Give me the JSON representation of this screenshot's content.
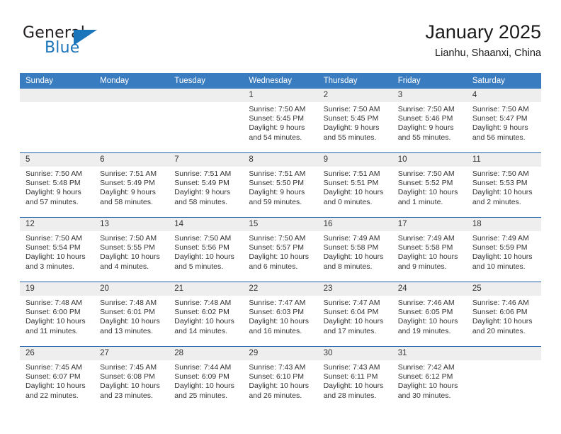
{
  "brand": {
    "name_part1": "General",
    "name_part2": "Blue",
    "logo_icon": "triangle-logo-icon",
    "accent_color": "#1b75bb"
  },
  "header": {
    "month_title": "January 2025",
    "location": "Lianhu, Shaanxi, China"
  },
  "calendar": {
    "header_bg": "#3a7cc0",
    "date_band_bg": "#eeeeee",
    "row_divider_color": "#1e5fa8",
    "weekday_headers": [
      "Sunday",
      "Monday",
      "Tuesday",
      "Wednesday",
      "Thursday",
      "Friday",
      "Saturday"
    ],
    "weeks": [
      [
        {
          "day": "",
          "empty": true,
          "sunrise": "",
          "sunset": "",
          "daylight_line1": "",
          "daylight_line2": ""
        },
        {
          "day": "",
          "empty": true,
          "sunrise": "",
          "sunset": "",
          "daylight_line1": "",
          "daylight_line2": ""
        },
        {
          "day": "",
          "empty": true,
          "sunrise": "",
          "sunset": "",
          "daylight_line1": "",
          "daylight_line2": ""
        },
        {
          "day": "1",
          "sunrise": "Sunrise: 7:50 AM",
          "sunset": "Sunset: 5:45 PM",
          "daylight_line1": "Daylight: 9 hours",
          "daylight_line2": "and 54 minutes."
        },
        {
          "day": "2",
          "sunrise": "Sunrise: 7:50 AM",
          "sunset": "Sunset: 5:45 PM",
          "daylight_line1": "Daylight: 9 hours",
          "daylight_line2": "and 55 minutes."
        },
        {
          "day": "3",
          "sunrise": "Sunrise: 7:50 AM",
          "sunset": "Sunset: 5:46 PM",
          "daylight_line1": "Daylight: 9 hours",
          "daylight_line2": "and 55 minutes."
        },
        {
          "day": "4",
          "sunrise": "Sunrise: 7:50 AM",
          "sunset": "Sunset: 5:47 PM",
          "daylight_line1": "Daylight: 9 hours",
          "daylight_line2": "and 56 minutes."
        }
      ],
      [
        {
          "day": "5",
          "sunrise": "Sunrise: 7:50 AM",
          "sunset": "Sunset: 5:48 PM",
          "daylight_line1": "Daylight: 9 hours",
          "daylight_line2": "and 57 minutes."
        },
        {
          "day": "6",
          "sunrise": "Sunrise: 7:51 AM",
          "sunset": "Sunset: 5:49 PM",
          "daylight_line1": "Daylight: 9 hours",
          "daylight_line2": "and 58 minutes."
        },
        {
          "day": "7",
          "sunrise": "Sunrise: 7:51 AM",
          "sunset": "Sunset: 5:49 PM",
          "daylight_line1": "Daylight: 9 hours",
          "daylight_line2": "and 58 minutes."
        },
        {
          "day": "8",
          "sunrise": "Sunrise: 7:51 AM",
          "sunset": "Sunset: 5:50 PM",
          "daylight_line1": "Daylight: 9 hours",
          "daylight_line2": "and 59 minutes."
        },
        {
          "day": "9",
          "sunrise": "Sunrise: 7:51 AM",
          "sunset": "Sunset: 5:51 PM",
          "daylight_line1": "Daylight: 10 hours",
          "daylight_line2": "and 0 minutes."
        },
        {
          "day": "10",
          "sunrise": "Sunrise: 7:50 AM",
          "sunset": "Sunset: 5:52 PM",
          "daylight_line1": "Daylight: 10 hours",
          "daylight_line2": "and 1 minute."
        },
        {
          "day": "11",
          "sunrise": "Sunrise: 7:50 AM",
          "sunset": "Sunset: 5:53 PM",
          "daylight_line1": "Daylight: 10 hours",
          "daylight_line2": "and 2 minutes."
        }
      ],
      [
        {
          "day": "12",
          "sunrise": "Sunrise: 7:50 AM",
          "sunset": "Sunset: 5:54 PM",
          "daylight_line1": "Daylight: 10 hours",
          "daylight_line2": "and 3 minutes."
        },
        {
          "day": "13",
          "sunrise": "Sunrise: 7:50 AM",
          "sunset": "Sunset: 5:55 PM",
          "daylight_line1": "Daylight: 10 hours",
          "daylight_line2": "and 4 minutes."
        },
        {
          "day": "14",
          "sunrise": "Sunrise: 7:50 AM",
          "sunset": "Sunset: 5:56 PM",
          "daylight_line1": "Daylight: 10 hours",
          "daylight_line2": "and 5 minutes."
        },
        {
          "day": "15",
          "sunrise": "Sunrise: 7:50 AM",
          "sunset": "Sunset: 5:57 PM",
          "daylight_line1": "Daylight: 10 hours",
          "daylight_line2": "and 6 minutes."
        },
        {
          "day": "16",
          "sunrise": "Sunrise: 7:49 AM",
          "sunset": "Sunset: 5:58 PM",
          "daylight_line1": "Daylight: 10 hours",
          "daylight_line2": "and 8 minutes."
        },
        {
          "day": "17",
          "sunrise": "Sunrise: 7:49 AM",
          "sunset": "Sunset: 5:58 PM",
          "daylight_line1": "Daylight: 10 hours",
          "daylight_line2": "and 9 minutes."
        },
        {
          "day": "18",
          "sunrise": "Sunrise: 7:49 AM",
          "sunset": "Sunset: 5:59 PM",
          "daylight_line1": "Daylight: 10 hours",
          "daylight_line2": "and 10 minutes."
        }
      ],
      [
        {
          "day": "19",
          "sunrise": "Sunrise: 7:48 AM",
          "sunset": "Sunset: 6:00 PM",
          "daylight_line1": "Daylight: 10 hours",
          "daylight_line2": "and 11 minutes."
        },
        {
          "day": "20",
          "sunrise": "Sunrise: 7:48 AM",
          "sunset": "Sunset: 6:01 PM",
          "daylight_line1": "Daylight: 10 hours",
          "daylight_line2": "and 13 minutes."
        },
        {
          "day": "21",
          "sunrise": "Sunrise: 7:48 AM",
          "sunset": "Sunset: 6:02 PM",
          "daylight_line1": "Daylight: 10 hours",
          "daylight_line2": "and 14 minutes."
        },
        {
          "day": "22",
          "sunrise": "Sunrise: 7:47 AM",
          "sunset": "Sunset: 6:03 PM",
          "daylight_line1": "Daylight: 10 hours",
          "daylight_line2": "and 16 minutes."
        },
        {
          "day": "23",
          "sunrise": "Sunrise: 7:47 AM",
          "sunset": "Sunset: 6:04 PM",
          "daylight_line1": "Daylight: 10 hours",
          "daylight_line2": "and 17 minutes."
        },
        {
          "day": "24",
          "sunrise": "Sunrise: 7:46 AM",
          "sunset": "Sunset: 6:05 PM",
          "daylight_line1": "Daylight: 10 hours",
          "daylight_line2": "and 19 minutes."
        },
        {
          "day": "25",
          "sunrise": "Sunrise: 7:46 AM",
          "sunset": "Sunset: 6:06 PM",
          "daylight_line1": "Daylight: 10 hours",
          "daylight_line2": "and 20 minutes."
        }
      ],
      [
        {
          "day": "26",
          "sunrise": "Sunrise: 7:45 AM",
          "sunset": "Sunset: 6:07 PM",
          "daylight_line1": "Daylight: 10 hours",
          "daylight_line2": "and 22 minutes."
        },
        {
          "day": "27",
          "sunrise": "Sunrise: 7:45 AM",
          "sunset": "Sunset: 6:08 PM",
          "daylight_line1": "Daylight: 10 hours",
          "daylight_line2": "and 23 minutes."
        },
        {
          "day": "28",
          "sunrise": "Sunrise: 7:44 AM",
          "sunset": "Sunset: 6:09 PM",
          "daylight_line1": "Daylight: 10 hours",
          "daylight_line2": "and 25 minutes."
        },
        {
          "day": "29",
          "sunrise": "Sunrise: 7:43 AM",
          "sunset": "Sunset: 6:10 PM",
          "daylight_line1": "Daylight: 10 hours",
          "daylight_line2": "and 26 minutes."
        },
        {
          "day": "30",
          "sunrise": "Sunrise: 7:43 AM",
          "sunset": "Sunset: 6:11 PM",
          "daylight_line1": "Daylight: 10 hours",
          "daylight_line2": "and 28 minutes."
        },
        {
          "day": "31",
          "sunrise": "Sunrise: 7:42 AM",
          "sunset": "Sunset: 6:12 PM",
          "daylight_line1": "Daylight: 10 hours",
          "daylight_line2": "and 30 minutes."
        },
        {
          "day": "",
          "empty": true,
          "sunrise": "",
          "sunset": "",
          "daylight_line1": "",
          "daylight_line2": ""
        }
      ]
    ]
  }
}
